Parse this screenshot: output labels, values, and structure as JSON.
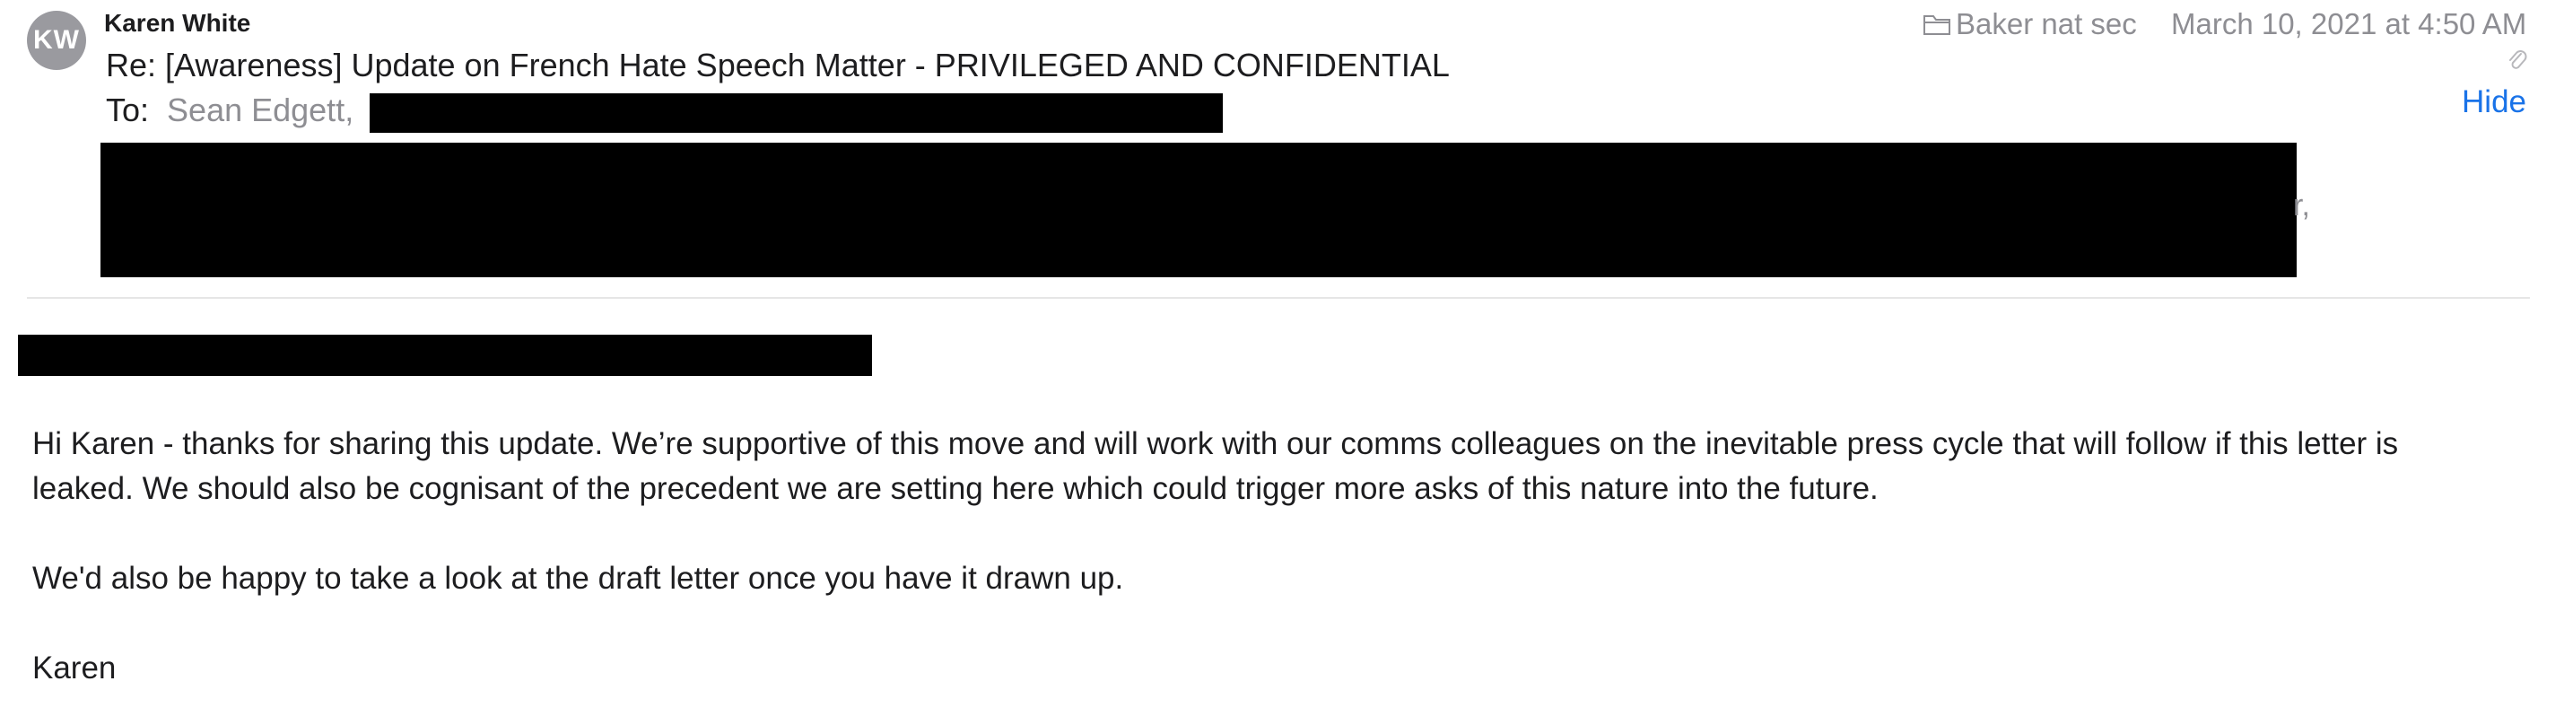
{
  "email": {
    "avatar_initials": "KW",
    "sender": "Karen White",
    "subject": "Re: [Awareness] Update on French Hate Speech Matter - PRIVILEGED AND CONFIDENTIAL",
    "to_label": "To:",
    "to_recipient": "Sean Edgett,",
    "mailbox": "Baker nat sec",
    "date": "March 10, 2021 at 4:50 AM",
    "hide_label": "Hide",
    "trailing_fragment": "r,",
    "body": {
      "paragraph_1_line_1": "Hi Karen - thanks for sharing this update. We’re supportive of this move and will work with our comms colleagues on the inevitable press cycle that will follow if this letter is",
      "paragraph_1_line_2": "leaked. We should also be cognisant of the precedent we are setting here which could trigger more asks of this nature into the future.",
      "paragraph_2": "We'd also be happy to take a look at the draft letter once you have it drawn up.",
      "signature": "Karen"
    }
  },
  "icons": {
    "folder": "folder-icon",
    "attachment": "paperclip-icon"
  },
  "colors": {
    "avatar_bg": "#9a9a9f",
    "link": "#1a73e8",
    "muted_text": "#8e8e93",
    "redaction": "#000000"
  }
}
